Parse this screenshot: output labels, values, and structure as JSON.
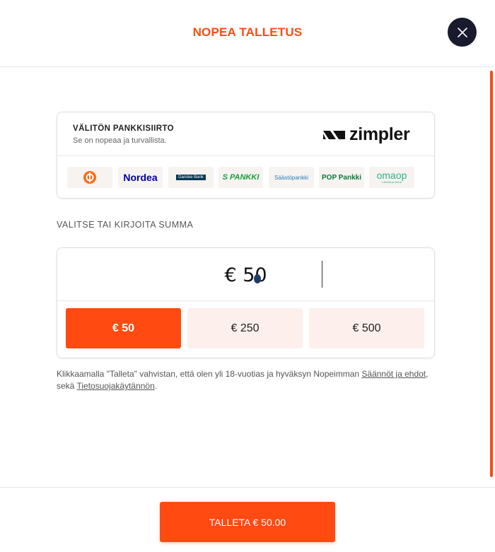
{
  "header": {
    "title": "NOPEA TALLETUS"
  },
  "payment_method": {
    "title": "VÄLITÖN PANKKISIIRTO",
    "subtitle": "Se on nopeaa ja turvallista.",
    "provider": "zimpler",
    "banks": [
      {
        "label": "",
        "icon": "op-logo-icon"
      },
      {
        "label": "Nordea"
      },
      {
        "label": "Danske Bank"
      },
      {
        "label": "S PANKKI"
      },
      {
        "label": "Säästöpankki"
      },
      {
        "label": "POP Pankki"
      },
      {
        "label": "omaop",
        "sub": "Lähellä ja läsnä"
      }
    ]
  },
  "amount": {
    "label": "VALITSE TAI KIRJOITA SUMMA",
    "value": "€ 50",
    "presets": [
      {
        "label": "€ 50",
        "selected": true
      },
      {
        "label": "€ 250",
        "selected": false
      },
      {
        "label": "€ 500",
        "selected": false
      }
    ]
  },
  "terms": {
    "text_before": "Klikkaamalla \"Talleta\" vahvistan, että olen yli 18-vuotias ja hyväksyn Nopeimman ",
    "link1": "Säännöt ja ehdot",
    "text_middle": ", sekä ",
    "link2": "Tietosuojakäytännön",
    "text_after": "."
  },
  "footer": {
    "submit_label": "TALLETA € 50.00"
  },
  "colors": {
    "accent": "#ff4a12",
    "chip_bg": "#fdf0ec",
    "close_bg": "#1a1a2e"
  }
}
